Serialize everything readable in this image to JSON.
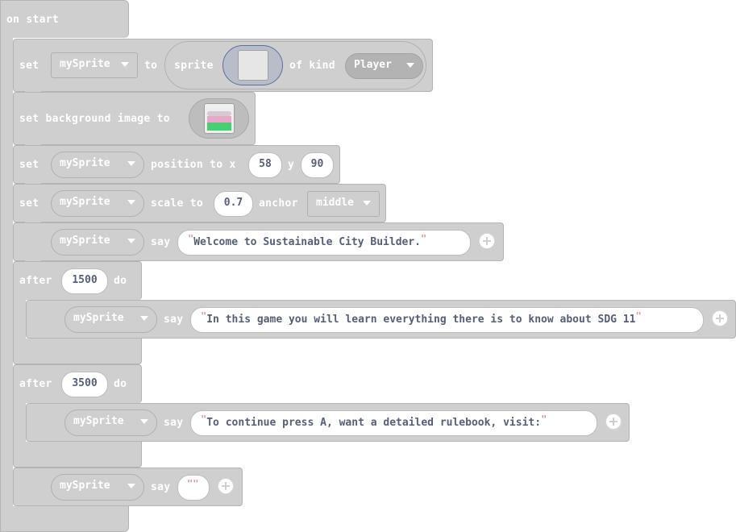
{
  "on_start": {
    "label": "on start"
  },
  "block1": {
    "set": "set",
    "var": "mySprite",
    "to": "to",
    "sprite": "sprite",
    "of_kind": "of kind",
    "kind": "Player"
  },
  "block2": {
    "label": "set background image to"
  },
  "block3": {
    "set": "set",
    "var": "mySprite",
    "position_to_x": "position to x",
    "x": "58",
    "y_label": "y",
    "y": "90"
  },
  "block4": {
    "set": "set",
    "var": "mySprite",
    "scale_to": "scale to",
    "scale": "0.7",
    "anchor": "anchor",
    "anchor_value": "middle"
  },
  "block5": {
    "var": "mySprite",
    "say": "say",
    "text": "Welcome to Sustainable City Builder."
  },
  "after1": {
    "after": "after",
    "ms": "1500",
    "do": "do",
    "var": "mySprite",
    "say": "say",
    "text": "In this game you will learn everything there is to know about SDG 11"
  },
  "after2": {
    "after": "after",
    "ms": "3500",
    "do": "do",
    "var": "mySprite",
    "say": "say",
    "text": "To continue press A, want a detailed rulebook, visit:"
  },
  "block8": {
    "var": "mySprite",
    "say": "say",
    "text": ""
  }
}
